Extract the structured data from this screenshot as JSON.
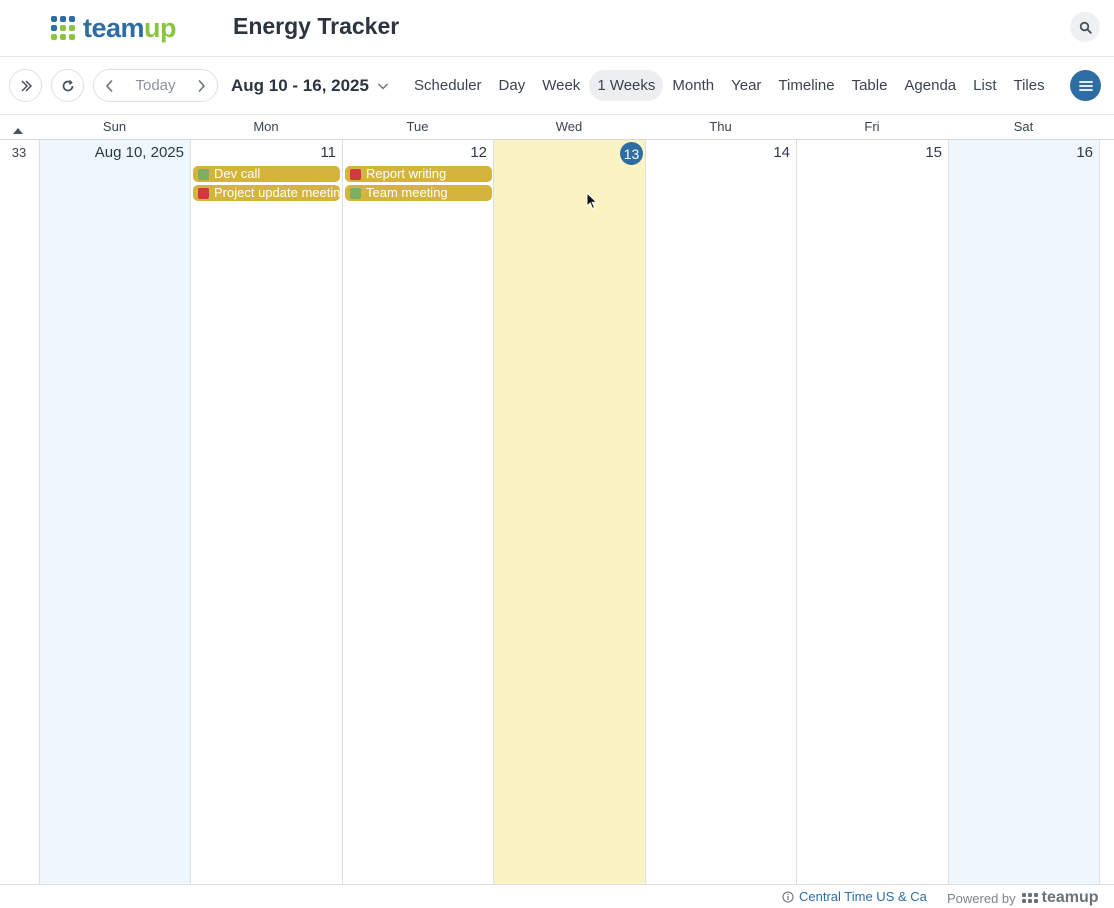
{
  "header": {
    "logo_part1": "team",
    "logo_part2": "up",
    "app_title": "Energy Tracker",
    "search_icon": "search-icon"
  },
  "toolbar": {
    "today_label": "Today",
    "date_range": "Aug 10 - 16, 2025",
    "views": [
      "Scheduler",
      "Day",
      "Week",
      "1 Weeks",
      "Month",
      "Year",
      "Timeline",
      "Table",
      "Agenda",
      "List",
      "Tiles"
    ],
    "active_view": "1 Weeks"
  },
  "calendar": {
    "week_number": "33",
    "day_names": [
      "Sun",
      "Mon",
      "Tue",
      "Wed",
      "Thu",
      "Fri",
      "Sat"
    ],
    "days": [
      {
        "label": "Aug 10, 2025",
        "type": "weekend"
      },
      {
        "label": "11",
        "type": "normal"
      },
      {
        "label": "12",
        "type": "normal"
      },
      {
        "label": "13",
        "type": "today"
      },
      {
        "label": "14",
        "type": "normal"
      },
      {
        "label": "15",
        "type": "normal"
      },
      {
        "label": "16",
        "type": "weekend"
      }
    ],
    "events": {
      "mon": [
        {
          "title": "Dev call",
          "swatch": "#7fae63"
        },
        {
          "title": "Project update meeting",
          "swatch": "#d3373f"
        }
      ],
      "tue": [
        {
          "title": "Report writing",
          "swatch": "#d3373f"
        },
        {
          "title": "Team meeting",
          "swatch": "#7fae63"
        }
      ]
    },
    "event_color": "#d4b43d"
  },
  "footer": {
    "timezone": "Central Time US & Ca",
    "powered_by": "Powered by",
    "brand": "teamup"
  },
  "colors": {
    "brand_blue": "#2e6da4",
    "brand_green": "#8bc53f",
    "weekend_bg": "#eef8fc",
    "today_bg": "#fcf3c2"
  }
}
